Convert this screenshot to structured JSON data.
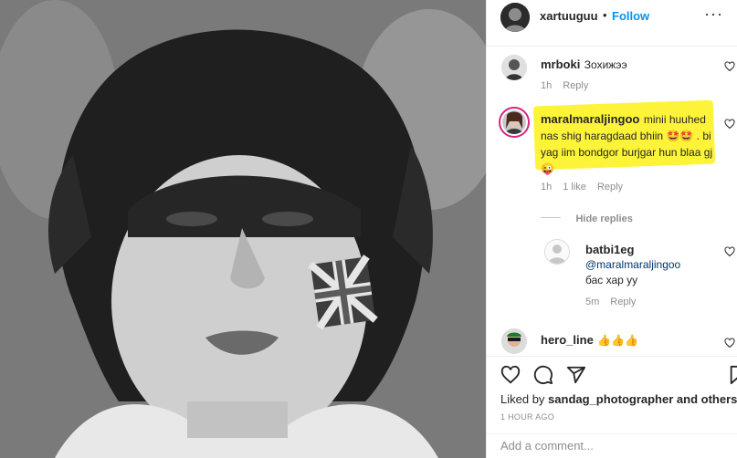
{
  "post": {
    "author": "xartuuguu",
    "separator": "•",
    "follow_label": "Follow",
    "more_glyph": "···"
  },
  "comments": [
    {
      "user": "mrboki",
      "text": "Зохижээ",
      "time": "1h",
      "reply": "Reply"
    },
    {
      "user": "maralmaraljingoo",
      "text": "minii huuhed nas shig haragdaad bhiin 🤩🤩 . bi yag iim bondgor burjgar hun blaa gj 😜",
      "time": "1h",
      "likes": "1 like",
      "reply": "Reply"
    }
  ],
  "replies_toggle": "Hide replies",
  "reply_comment": {
    "user": "batbi1eg",
    "mention": "@maralmaraljingoo",
    "text": "бас хар уу",
    "time": "5m",
    "reply": "Reply"
  },
  "last_comment": {
    "user": "hero_line",
    "text": "👍👍👍"
  },
  "likes": {
    "prefix": "Liked by ",
    "user": "sandag_photographer",
    "suffix": " and others"
  },
  "timestamp": "1 HOUR AGO",
  "add_comment_placeholder": "Add a comment...",
  "colors": {
    "accent": "#0095f6",
    "highlight": "#fdf43a",
    "meta": "#8e8e8e"
  },
  "icons": [
    "heart-icon",
    "comment-icon",
    "share-icon",
    "bookmark-icon",
    "more-icon"
  ]
}
